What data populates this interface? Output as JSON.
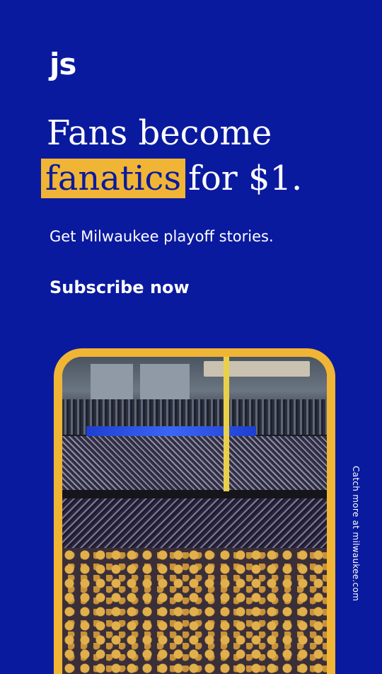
{
  "brand": {
    "logo_text": "js"
  },
  "headline": {
    "line1": "Fans become",
    "highlight": "fanatics",
    "line2_rest": "for $1."
  },
  "subtitle": "Get Milwaukee playoff stories.",
  "cta": {
    "label": "Subscribe now"
  },
  "side_link": "Catch more at milwaukee.com",
  "colors": {
    "background": "#0a1a9e",
    "accent": "#f1b535",
    "text": "#ffffff"
  }
}
